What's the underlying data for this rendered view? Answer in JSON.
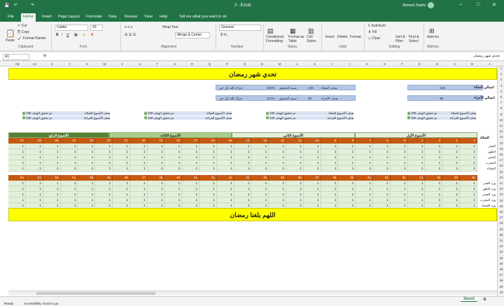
{
  "window": {
    "title": "2 - Excel",
    "user": "Ahmed Sobhi"
  },
  "tabs": [
    "File",
    "Home",
    "Insert",
    "Page Layout",
    "Formulas",
    "Data",
    "Review",
    "View",
    "Help",
    "Tell me what you want to do"
  ],
  "ribbon": {
    "paste": "Paste",
    "cut": "Cut",
    "copy": "Copy",
    "format_painter": "Format Painter",
    "font_name": "Calibri",
    "font_size": "20",
    "wrap": "Wrap Text",
    "merge": "Merge & Center",
    "number_format": "General",
    "cond": "Conditional Formatting",
    "format_table": "Format as Table",
    "cell_styles": "Cell Styles",
    "insert": "Insert",
    "delete": "Delete",
    "format": "Format",
    "autosum": "AutoSum",
    "fill": "Fill",
    "clear": "Clear",
    "sort": "Sort & Filter",
    "find": "Find & Select",
    "addins": "Add-ins",
    "groups": {
      "clipboard": "Clipboard",
      "font": "Font",
      "alignment": "Alignment",
      "number": "Number",
      "styles": "Styles",
      "cells": "Cells",
      "editing": "Editing",
      "addins": "Add-ins"
    }
  },
  "formula_bar": {
    "name_box": "A1",
    "fx": "fx",
    "content": "تحدي شهر رمضان"
  },
  "columns": [
    "AB",
    "AA",
    "Z",
    "Y",
    "X",
    "W",
    "V",
    "U",
    "T",
    "S",
    "R",
    "Q",
    "P",
    "O",
    "N",
    "M",
    "L",
    "K",
    "J",
    "I",
    "H",
    "G",
    "F",
    "E",
    "D",
    "C",
    "B",
    "A"
  ],
  "sheet": {
    "title": "تحدي شهر رمضان",
    "footer": "اللهم بلغنا رمضان",
    "prayer_total_label": "اجمالي الصلاة",
    "prayer_total": "145",
    "quran_total_label": "اجمالي الأجزاء",
    "quran_total": "35",
    "goal_prayer_label": "هدف الصلاة",
    "goal_prayer": "145",
    "achieve_label": "نسبة التحقيق",
    "achieve_prayer": "100%",
    "goal_quran_label": "هدف الأجزاء",
    "goal_quran": "30",
    "achieve_quran": "117%",
    "praise": "جزاك الله كل خير",
    "weekly_prayer_goal": "هدف الأسبوع الصلاة",
    "weekly_quran_goal": "هدف الأسبوع القراءة",
    "achieved": "تم تحقيق الهدف",
    "hundred": "100",
    "weeks": [
      "الأسبوع الأول",
      "الأسبوع الثاني",
      "الأسبوع الثالث",
      "الأسبوع الرابع"
    ],
    "prayer_label": "الصلاة",
    "reading_label": "القراءة",
    "prayers": [
      "الفجر",
      "الظهر",
      "العصر",
      "المغرب",
      "العشاء"
    ],
    "reading_rows": [
      "ورد الفجر",
      "ورد الظهر",
      "ورد العصر",
      "ورد المغرب",
      "ورد العشاء"
    ],
    "days_top": [
      "1",
      "2",
      "3",
      "4",
      "5",
      "6",
      "7",
      "8",
      "9",
      "10",
      "11",
      "12",
      "13",
      "14",
      "15",
      "16",
      "17",
      "18",
      "19",
      "20",
      "21",
      "22",
      "23",
      "24",
      "25",
      "26",
      "27"
    ],
    "days_bottom": [
      "28",
      "29",
      "30",
      "31",
      "32",
      "33",
      "34",
      "35",
      "36",
      "37",
      "38",
      "39",
      "40",
      "41",
      "42",
      "43",
      "44",
      "45",
      "46",
      "47",
      "48",
      "49",
      "50",
      "51",
      "52",
      "53",
      "54",
      "55"
    ]
  },
  "sheet_tab": "Sheet1",
  "status": {
    "ready": "Ready",
    "accessibility": "Accessibility: Good to go"
  }
}
